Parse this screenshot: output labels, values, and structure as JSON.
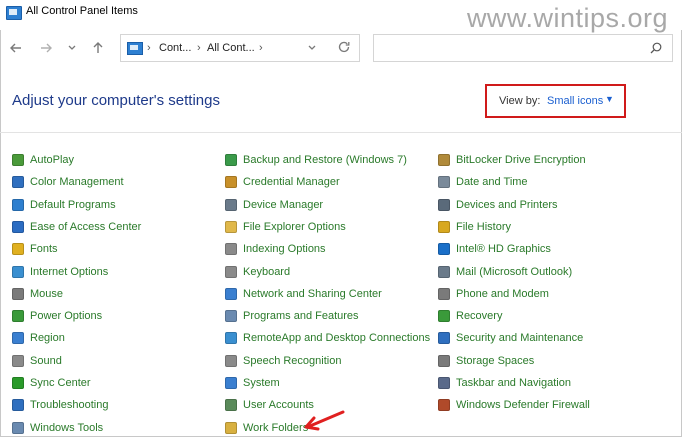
{
  "window": {
    "title": "All Control Panel Items",
    "watermark": "www.wintips.org"
  },
  "nav": {
    "back_icon": "arrow-left-icon",
    "forward_icon": "arrow-right-icon",
    "recent_icon": "chevron-down-icon",
    "up_icon": "arrow-up-icon",
    "breadcrumb": [
      "Cont...",
      "All Cont..."
    ],
    "refresh_icon": "refresh-icon",
    "search_placeholder": ""
  },
  "header": {
    "title": "Adjust your computer's settings",
    "view_by_label": "View by:",
    "view_by_value": "Small icons"
  },
  "columns": [
    {
      "items": [
        {
          "label": "AutoPlay",
          "icon": "autoplay-icon",
          "color": "#4a9a3a"
        },
        {
          "label": "Color Management",
          "icon": "color-management-icon",
          "color": "#2f6fbf"
        },
        {
          "label": "Default Programs",
          "icon": "default-programs-icon",
          "color": "#2e7fcf"
        },
        {
          "label": "Ease of Access Center",
          "icon": "ease-of-access-icon",
          "color": "#2b6cc2"
        },
        {
          "label": "Fonts",
          "icon": "fonts-icon",
          "color": "#e0b020"
        },
        {
          "label": "Internet Options",
          "icon": "internet-options-icon",
          "color": "#3a8fd0"
        },
        {
          "label": "Mouse",
          "icon": "mouse-icon",
          "color": "#7a7a7a"
        },
        {
          "label": "Power Options",
          "icon": "power-options-icon",
          "color": "#3a9a3a"
        },
        {
          "label": "Region",
          "icon": "region-icon",
          "color": "#3a7fd0"
        },
        {
          "label": "Sound",
          "icon": "sound-icon",
          "color": "#8a8a8a"
        },
        {
          "label": "Sync Center",
          "icon": "sync-center-icon",
          "color": "#2a9a2a"
        },
        {
          "label": "Troubleshooting",
          "icon": "troubleshooting-icon",
          "color": "#2f6fbf"
        },
        {
          "label": "Windows Tools",
          "icon": "windows-tools-icon",
          "color": "#6a8ab0"
        }
      ]
    },
    {
      "items": [
        {
          "label": "Backup and Restore (Windows 7)",
          "icon": "backup-restore-icon",
          "color": "#3a9a4a"
        },
        {
          "label": "Credential Manager",
          "icon": "credential-manager-icon",
          "color": "#c8902a"
        },
        {
          "label": "Device Manager",
          "icon": "device-manager-icon",
          "color": "#6a7a8a"
        },
        {
          "label": "File Explorer Options",
          "icon": "file-explorer-options-icon",
          "color": "#e0b84a"
        },
        {
          "label": "Indexing Options",
          "icon": "indexing-options-icon",
          "color": "#8a8a8a"
        },
        {
          "label": "Keyboard",
          "icon": "keyboard-icon",
          "color": "#8a8a8a"
        },
        {
          "label": "Network and Sharing Center",
          "icon": "network-sharing-icon",
          "color": "#3a7fd0"
        },
        {
          "label": "Programs and Features",
          "icon": "programs-features-icon",
          "color": "#6a8ab0"
        },
        {
          "label": "RemoteApp and Desktop Connections",
          "icon": "remoteapp-icon",
          "color": "#3a8fd0"
        },
        {
          "label": "Speech Recognition",
          "icon": "speech-recognition-icon",
          "color": "#8a8a8a"
        },
        {
          "label": "System",
          "icon": "system-icon",
          "color": "#3a7fd0"
        },
        {
          "label": "User Accounts",
          "icon": "user-accounts-icon",
          "color": "#5a8a5a"
        },
        {
          "label": "Work Folders",
          "icon": "work-folders-icon",
          "color": "#d8b040"
        }
      ]
    },
    {
      "items": [
        {
          "label": "BitLocker Drive Encryption",
          "icon": "bitlocker-icon",
          "color": "#b08a3a"
        },
        {
          "label": "Date and Time",
          "icon": "date-time-icon",
          "color": "#7a8a9a"
        },
        {
          "label": "Devices and Printers",
          "icon": "devices-printers-icon",
          "color": "#5a6a7a"
        },
        {
          "label": "File History",
          "icon": "file-history-icon",
          "color": "#d8a820"
        },
        {
          "label": "Intel® HD Graphics",
          "icon": "intel-graphics-icon",
          "color": "#1a6fc8"
        },
        {
          "label": "Mail (Microsoft Outlook)",
          "icon": "mail-icon",
          "color": "#6a7a8a"
        },
        {
          "label": "Phone and Modem",
          "icon": "phone-modem-icon",
          "color": "#7a7a7a"
        },
        {
          "label": "Recovery",
          "icon": "recovery-icon",
          "color": "#3a9a3a"
        },
        {
          "label": "Security and Maintenance",
          "icon": "security-maintenance-icon",
          "color": "#2f6fbf"
        },
        {
          "label": "Storage Spaces",
          "icon": "storage-spaces-icon",
          "color": "#7a7a7a"
        },
        {
          "label": "Taskbar and Navigation",
          "icon": "taskbar-navigation-icon",
          "color": "#5a6a8a"
        },
        {
          "label": "Windows Defender Firewall",
          "icon": "firewall-icon",
          "color": "#b04a2a"
        }
      ]
    }
  ],
  "colors": {
    "link": "#2a7a2a",
    "title": "#1e3a8a",
    "accent": "#1a5fd0",
    "highlight": "#d01a1a"
  }
}
